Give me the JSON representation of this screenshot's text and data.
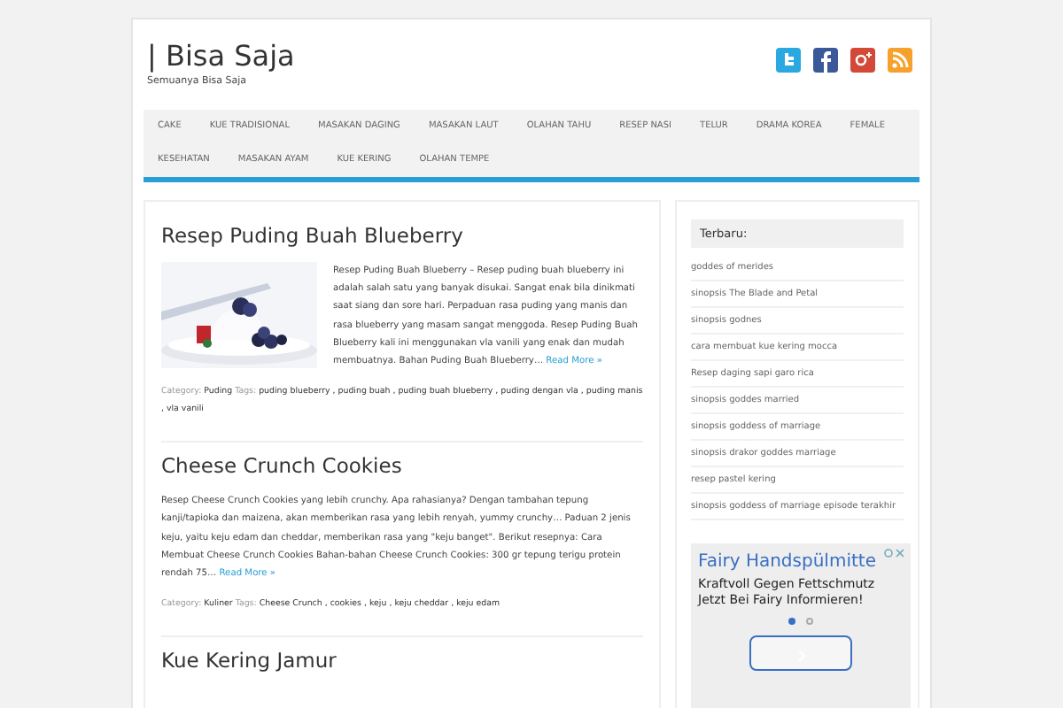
{
  "site": {
    "title": "| Bisa Saja",
    "tagline": "Semuanya Bisa Saja"
  },
  "social": [
    {
      "kind": "twitter"
    },
    {
      "kind": "facebook"
    },
    {
      "kind": "googleplus"
    },
    {
      "kind": "rss"
    }
  ],
  "nav": [
    "CAKE",
    "KUE TRADISIONAL",
    "MASAKAN DAGING",
    "MASAKAN LAUT",
    "OLAHAN TAHU",
    "RESEP NASI",
    "TELUR",
    "DRAMA KOREA",
    "FEMALE",
    "KESEHATAN",
    "MASAKAN AYAM",
    "KUE KERING",
    "OLAHAN TEMPE"
  ],
  "posts": [
    {
      "title": "Resep Puding Buah Blueberry",
      "has_image": true,
      "excerpt": "Resep Puding Buah Blueberry – Resep puding buah blueberry ini adalah salah satu yang banyak disukai. Sangat enak bila dinikmati saat siang dan sore hari. Perpaduan rasa puding yang manis dan rasa blueberry yang masam sangat menggoda. Resep Puding Buah Blueberry kali ini menggunakan vla vanili yang enak dan mudah membuatnya. Bahan Puding Buah Blueberry…",
      "read_more": "Read More »",
      "category_label": "Category:",
      "category": "Puding",
      "tags_label": "Tags:",
      "tag_separator": ",",
      "tags": [
        "puding blueberry",
        "puding buah",
        "puding buah blueberry",
        "puding dengan vla",
        "puding manis",
        "vla vanili"
      ]
    },
    {
      "title": "Cheese Crunch Cookies",
      "has_image": false,
      "excerpt": "Resep Cheese Crunch Cookies yang lebih crunchy. Apa rahasianya? Dengan tambahan tepung kanji/tapioka dan maizena, akan memberikan rasa yang lebih renyah, yummy crunchy… Paduan 2 jenis keju, yaitu keju edam dan cheddar, memberikan rasa yang \"keju banget\". Berikut resepnya: Cara Membuat Cheese Crunch Cookies Bahan-bahan Cheese Crunch Cookies: 300 gr tepung terigu protein rendah 75…",
      "read_more": "Read More »",
      "category_label": "Category:",
      "category": "Kuliner",
      "tags_label": "Tags:",
      "tag_separator": ",",
      "tags": [
        "Cheese Crunch",
        "cookies",
        "keju",
        "keju cheddar",
        "keju edam"
      ]
    },
    {
      "title": "Kue Kering Jamur"
    }
  ],
  "sidebar": {
    "heading": "Terbaru:",
    "links": [
      "goddes of merides",
      "sinopsis The Blade and Petal",
      "sinopsis godnes",
      "cara membuat kue kering mocca",
      "Resep daging sapi garo rica",
      "sinopsis goddes married",
      "sinopsis goddess of marriage",
      "sinopsis drakor goddes marriage",
      "resep pastel kering",
      "sinopsis goddess of marriage episode terakhir"
    ]
  },
  "ad": {
    "headline": "Fairy Handspülmitte",
    "body": "Kraftvoll Gegen Fettschmutz Jetzt Bei Fairy Informieren!",
    "pages": [
      {
        "selected": true
      },
      {
        "selected": false
      }
    ]
  }
}
